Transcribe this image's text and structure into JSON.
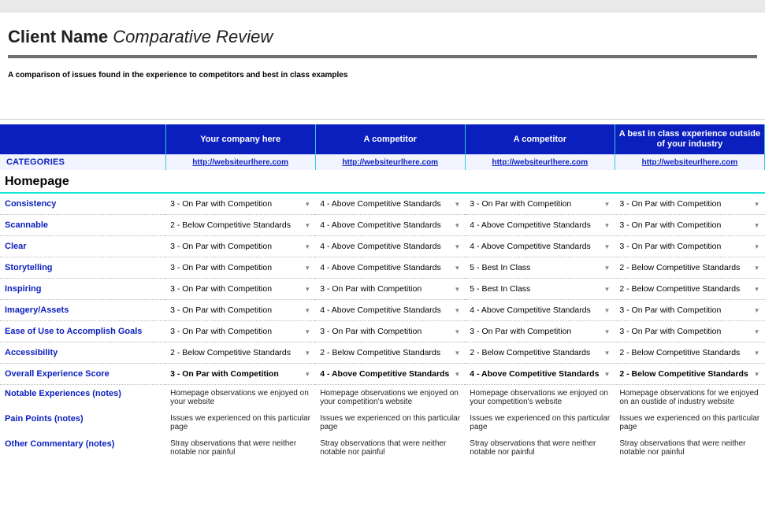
{
  "header": {
    "client": "Client Name",
    "suffix": "Comparative Review",
    "subtitle": "A comparison of issues found in the experience to competitors and best in class examples"
  },
  "columns": {
    "cat_label": "CATEGORIES",
    "headers": [
      "Your company here",
      "A competitor",
      "A competitor",
      "A best in class experience outside of your industry"
    ],
    "urls": [
      "http://websiteurlhere.com",
      "http://websiteurlhere.com",
      "http://websiteurlhere.com",
      "http://websiteurlhere.com"
    ]
  },
  "section": "Homepage",
  "rows": [
    {
      "label": "Consistency",
      "v": [
        "3 - On Par with Competition",
        "4 - Above Competitive Standards",
        "3 - On Par with Competition",
        "3 - On Par with Competition"
      ]
    },
    {
      "label": "Scannable",
      "v": [
        "2 - Below Competitive Standards",
        "4 - Above Competitive Standards",
        "4 - Above Competitive Standards",
        "3 - On Par with Competition"
      ]
    },
    {
      "label": "Clear",
      "v": [
        "3 - On Par with Competition",
        "4 - Above Competitive Standards",
        "4 - Above Competitive Standards",
        "3 - On Par with Competition"
      ]
    },
    {
      "label": "Storytelling",
      "v": [
        "3 - On Par with Competition",
        "4 - Above Competitive Standards",
        "5 - Best In Class",
        "2 - Below Competitive Standards"
      ]
    },
    {
      "label": "Inspiring",
      "v": [
        "3 - On Par with Competition",
        "3 - On Par with Competition",
        "5 - Best In Class",
        "2 - Below Competitive Standards"
      ]
    },
    {
      "label": "Imagery/Assets",
      "v": [
        "3 - On Par with Competition",
        "4 - Above Competitive Standards",
        "4 - Above Competitive Standards",
        "3 - On Par with Competition"
      ]
    },
    {
      "label": "Ease of Use to Accomplish Goals",
      "v": [
        "3 - On Par with Competition",
        "3 - On Par with Competition",
        "3 - On Par with Competition",
        "3 - On Par with Competition"
      ]
    },
    {
      "label": "Accessibility",
      "v": [
        "2 - Below Competitive Standards",
        "2 - Below Competitive Standards",
        "2 - Below Competitive Standards",
        "2 - Below Competitive Standards"
      ]
    }
  ],
  "score": {
    "label": "Overall Experience Score",
    "v": [
      "3 - On Par with Competition",
      "4 - Above Competitive Standards",
      "4 - Above Competitive Standards",
      "2 - Below Competitive Standards"
    ]
  },
  "notes": [
    {
      "label": "Notable Experiences (notes)",
      "v": [
        "Homepage observations we enjoyed on your website",
        "Homepage observations we enjoyed on your competition's website",
        "Homepage observations we enjoyed on your competition's website",
        "Homepage observations for we enjoyed on an oustide of industry website"
      ]
    },
    {
      "label": "Pain Points (notes)",
      "v": [
        "Issues we experienced on this particular page",
        "Issues we experienced on this particular page",
        "Issues we experienced on this particular page",
        "Issues we experienced on this particular page"
      ]
    },
    {
      "label": "Other Commentary (notes)",
      "v": [
        "Stray observations that were neither notable nor painful",
        "Stray observations that were neither notable nor painful",
        "Stray observations that were neither notable nor painful",
        "Stray observations that were neither notable nor painful"
      ]
    }
  ],
  "colors": {
    "brand_blue": "#0b1fbe",
    "teal_rule": "#17e6d8",
    "teal_border": "#2fcfe0"
  }
}
